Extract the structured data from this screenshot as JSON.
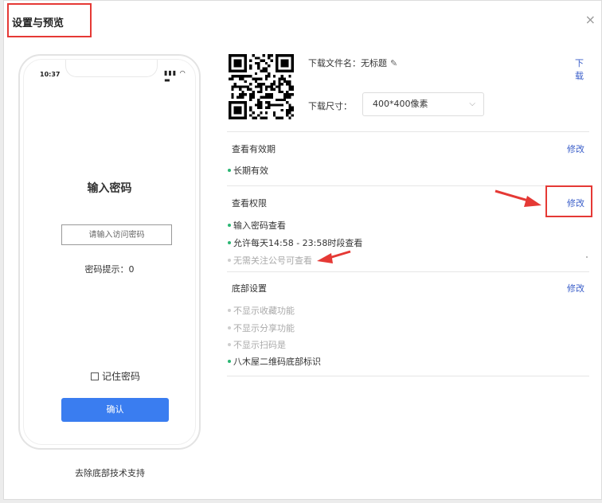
{
  "dialog": {
    "title": "设置与预览",
    "close_label": "×"
  },
  "phone": {
    "time": "10:37",
    "status_icons": "▮▮▮ ◠ ▬",
    "password_title": "输入密码",
    "password_placeholder": "请输入访问密码",
    "password_hint": "密码提示：0",
    "remember_label": "记住密码",
    "confirm_label": "确认"
  },
  "footer": {
    "remove_link": "去除底部技术支持"
  },
  "file": {
    "name_label": "下载文件名：无标题",
    "download_label": "下载",
    "size_label": "下载尺寸：",
    "size_value": "400*400像素"
  },
  "sections": {
    "validity": {
      "title": "查看有效期",
      "modify_label": "修改",
      "items": [
        {
          "text": "长期有效",
          "enabled": true
        }
      ]
    },
    "permissions": {
      "title": "查看权限",
      "modify_label": "修改",
      "items": [
        {
          "text": "输入密码查看",
          "enabled": true
        },
        {
          "text": "允许每天14:58 - 23:58时段查看",
          "enabled": true
        },
        {
          "text": "无需关注公号可查看",
          "enabled": false
        }
      ]
    },
    "bottom": {
      "title": "底部设置",
      "modify_label": "修改",
      "items": [
        {
          "text": "不显示收藏功能",
          "enabled": false
        },
        {
          "text": "不显示分享功能",
          "enabled": false
        },
        {
          "text": "不显示扫码是",
          "enabled": false
        },
        {
          "text": "八木屋二维码底部标识",
          "enabled": true
        }
      ]
    }
  },
  "colors": {
    "accent": "#3a5ec9",
    "button": "#3a7df0",
    "annotation": "#e53935",
    "enabled_dot": "#2bb673",
    "disabled_dot": "#cfcfcf"
  }
}
